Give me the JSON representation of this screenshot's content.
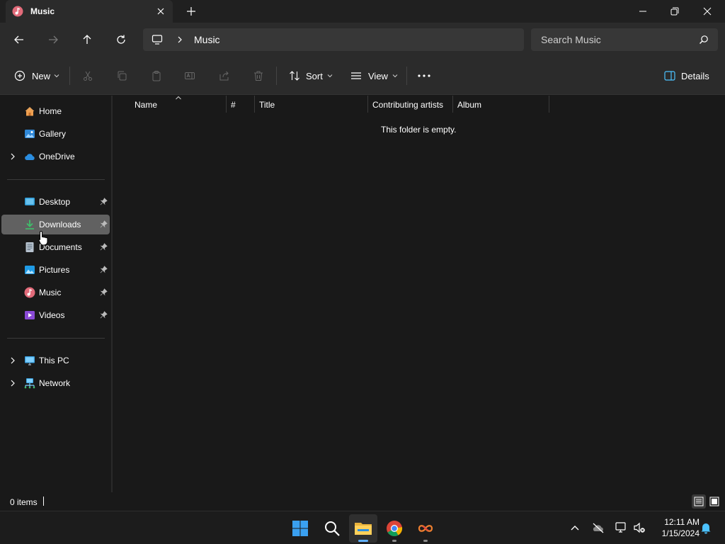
{
  "window": {
    "tab_title": "Music",
    "colors": {
      "background": "#191919",
      "toolbar": "#2b2b2b",
      "selection": "#616161",
      "accent": "#0078d4"
    }
  },
  "nav": {
    "breadcrumb": [
      "Music"
    ],
    "search_placeholder": "Search Music"
  },
  "commandbar": {
    "new_label": "New",
    "sort_label": "Sort",
    "view_label": "View",
    "details_label": "Details"
  },
  "sidebar": {
    "items": [
      {
        "label": "Home",
        "icon": "home-icon"
      },
      {
        "label": "Gallery",
        "icon": "gallery-icon"
      },
      {
        "label": "OneDrive",
        "icon": "onedrive-icon"
      },
      {
        "label": "Desktop",
        "icon": "desktop-icon",
        "pinned": true
      },
      {
        "label": "Downloads",
        "icon": "downloads-icon",
        "pinned": true,
        "selected": true
      },
      {
        "label": "Documents",
        "icon": "documents-icon",
        "pinned": true
      },
      {
        "label": "Pictures",
        "icon": "pictures-icon",
        "pinned": true
      },
      {
        "label": "Music",
        "icon": "music-icon",
        "pinned": true
      },
      {
        "label": "Videos",
        "icon": "videos-icon",
        "pinned": true
      },
      {
        "label": "This PC",
        "icon": "this-pc-icon"
      },
      {
        "label": "Network",
        "icon": "network-icon"
      }
    ]
  },
  "content": {
    "columns": [
      "Name",
      "#",
      "Title",
      "Contributing artists",
      "Album"
    ],
    "empty_message": "This folder is empty."
  },
  "status": {
    "item_count": "0 items"
  },
  "taskbar": {
    "apps": [
      "start-icon",
      "search-icon",
      "file-explorer-icon",
      "chrome-icon",
      "infinity-app-icon"
    ],
    "time": "12:11 AM",
    "date": "1/15/2024"
  }
}
